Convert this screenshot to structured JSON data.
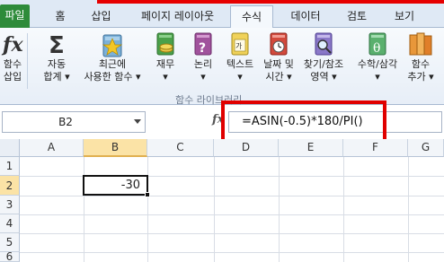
{
  "tabs": [
    {
      "label": "파일",
      "type": "file"
    },
    {
      "label": "홈"
    },
    {
      "label": "삽입"
    },
    {
      "label": "페이지 레이아웃"
    },
    {
      "label": "수식",
      "active": true
    },
    {
      "label": "데이터"
    },
    {
      "label": "검토"
    },
    {
      "label": "보기"
    }
  ],
  "ribbon": {
    "insert_function": {
      "line1": "함수",
      "line2": "삽입",
      "icon": "fx-icon"
    },
    "autosum": {
      "line1": "자동",
      "line2": "합계 ▾",
      "icon": "sigma-icon"
    },
    "recent": {
      "line1": "최근에",
      "line2": "사용한 함수 ▾",
      "icon": "star-book-icon"
    },
    "financial": {
      "line1": "재무",
      "line2": "▾",
      "icon": "coins-book-icon"
    },
    "logical": {
      "line1": "논리",
      "line2": "▾",
      "icon": "question-book-icon"
    },
    "text": {
      "line1": "텍스트",
      "line2": "▾",
      "icon": "text-book-icon"
    },
    "datetime": {
      "line1": "날짜 및",
      "line2": "시간 ▾",
      "icon": "clock-book-icon"
    },
    "lookup": {
      "line1": "찾기/참조",
      "line2": "영역 ▾",
      "icon": "magnifier-book-icon"
    },
    "math": {
      "line1": "수학/삼각",
      "line2": "▾",
      "icon": "theta-book-icon"
    },
    "more": {
      "line1": "함수",
      "line2": "추가 ▾",
      "icon": "more-books-icon"
    },
    "group_label": "함수 라이브러리"
  },
  "formula_bar": {
    "name_box": "B2",
    "fx_label": "fx",
    "formula": "=ASIN(-0.5)*180/PI()"
  },
  "sheet": {
    "columns": [
      "A",
      "B",
      "C",
      "D",
      "E",
      "F",
      "G"
    ],
    "rows": [
      "1",
      "2",
      "3",
      "4",
      "5",
      "6"
    ],
    "selected_column": "B",
    "selected_row": "2",
    "active_cell_value": "-30"
  },
  "colors": {
    "file_tab": "#2e8b3a",
    "highlight_box": "#e00000",
    "selected_header": "#fbe3a6"
  }
}
